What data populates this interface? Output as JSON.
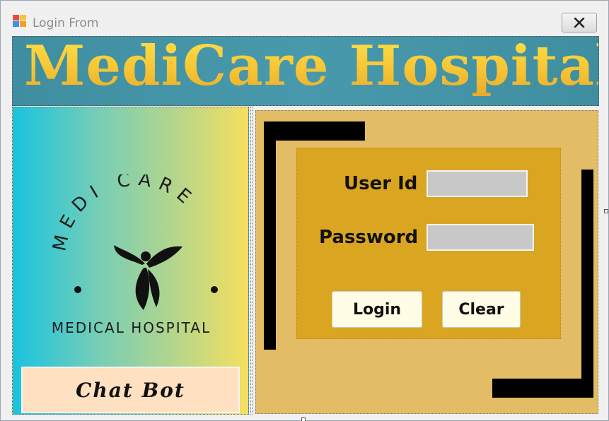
{
  "window": {
    "title": "Login From"
  },
  "banner": {
    "title": "MediCare Hospital"
  },
  "logo": {
    "arc_text": "MEDI CARE",
    "caption": "MEDICAL HOSPITAL"
  },
  "chatbot": {
    "label": "Chat Bot"
  },
  "login_form": {
    "user_id_label": "User Id",
    "user_id_value": "",
    "password_label": "Password",
    "password_value": "",
    "login_label": "Login",
    "clear_label": "Clear"
  },
  "colors": {
    "banner_bg": "#4999ad",
    "banner_text": "#f7c534",
    "right_panel_bg": "#e3bc66",
    "login_box_bg": "#daa520",
    "input_bg": "#c8c8c8",
    "button_bg": "#fffde6",
    "chatbot_bg": "#ffe0c0"
  },
  "icons": {
    "app": "windows-form-icon",
    "close": "close-icon",
    "logo": "leaf-person-icon"
  }
}
